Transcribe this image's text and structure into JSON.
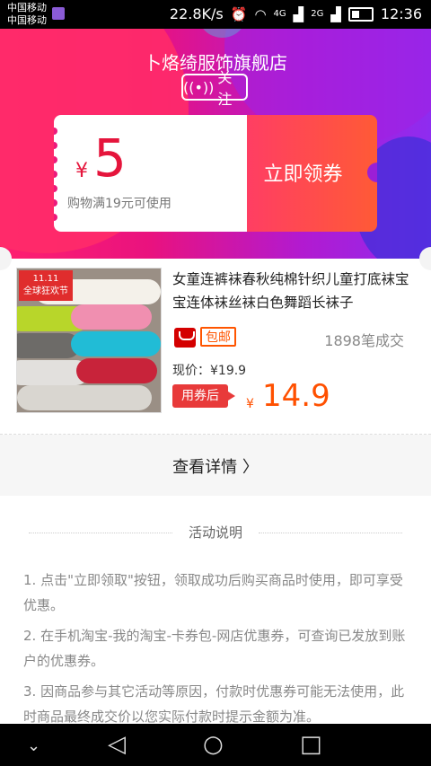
{
  "status_bar": {
    "carrier1": "中国移动",
    "carrier2": "中国移动",
    "speed": "22.8K/s",
    "net1": "4G",
    "net2": "2G",
    "time": "12:36"
  },
  "shop": {
    "name": "卜烙绮服饰旗舰店",
    "follow_label": "关注"
  },
  "coupon": {
    "currency": "¥",
    "amount": "5",
    "condition": "购物满19元可使用",
    "claim_label": "立即领券"
  },
  "product": {
    "image_badge_top": "11.11",
    "image_badge_bottom": "全球狂欢节",
    "title": "女童连裤袜春秋纯棉针织儿童打底袜宝宝连体袜丝袜白色舞蹈长袜子",
    "free_shipping": "包邮",
    "sold": "1898笔成交",
    "current_price": "现价：¥19.9",
    "after_coupon_label": "用券后",
    "final_currency": "¥",
    "final_price": "14.9"
  },
  "details_link": "查看详情 〉",
  "rules": {
    "heading": "活动说明",
    "items": [
      "1. 点击\"立即领取\"按钮，领取成功后购买商品时使用，即可享受优惠。",
      "2. 在手机淘宝-我的淘宝-卡券包-网店优惠券，可查询已发放到账户的优惠券。",
      "3. 因商品参与其它活动等原因，付款时优惠券可能无法使用，此时商品最终成交价以您实际付款时提示金额为准。"
    ]
  },
  "colors": {
    "accent": "#e5153c",
    "price": "#ff5000"
  }
}
